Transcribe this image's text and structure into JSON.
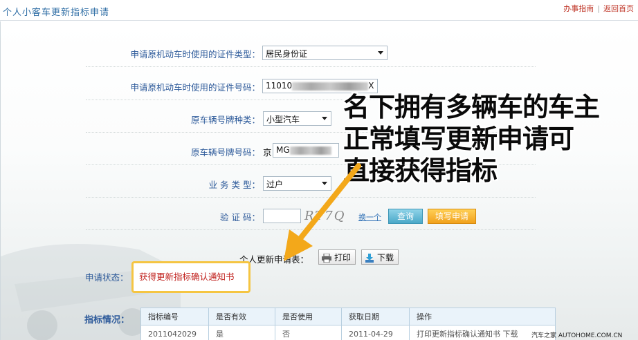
{
  "header": {
    "title": "个人小客车更新指标申请",
    "link_guide": "办事指南",
    "link_home": "返回首页"
  },
  "form": {
    "id_type_label": "申请原机动车时使用的证件类型：",
    "id_type_value": "居民身份证",
    "id_number_label": "申请原机动车时使用的证件号码：",
    "id_number_prefix": "11010",
    "id_number_suffix": "X",
    "plate_type_label": "原车辆号牌种类：",
    "plate_type_value": "小型汽车",
    "plate_number_label": "原车辆号牌号码：",
    "plate_prefix": "京",
    "plate_value_prefix": "MG",
    "business_type_label": "业 务 类 型：",
    "business_type_value": "过户",
    "captcha_label": "验 证 码：",
    "captcha_text": "RT7Q",
    "refresh_link": "换一个",
    "query_button": "查询",
    "apply_button": "填写申请"
  },
  "actions": {
    "form_label": "个人更新申请表：",
    "print_button": "打印",
    "download_button": "下载"
  },
  "status": {
    "label": "申请状态：",
    "value": "获得更新指标确认通知书"
  },
  "indicator": {
    "label": "指标情况：",
    "columns": [
      "指标编号",
      "是否有效",
      "是否使用",
      "获取日期",
      "操作"
    ],
    "rows": [
      {
        "id": "2011042029",
        "valid": "是",
        "used": "否",
        "date": "2011-04-29",
        "op_print": "打印更新指标确认通知书",
        "op_download": "下载"
      }
    ]
  },
  "annotation": {
    "line1": "名下拥有多辆车的车主",
    "line2": "正常填写更新申请可",
    "line3": "直接获得指标"
  },
  "watermark": "汽车之家 AUTOHOME.COM.CN",
  "colors": {
    "link_blue": "#2d5a9a",
    "status_red": "#c0201c",
    "highlight_yellow": "#f5c542",
    "arrow_orange": "#f3a81a"
  }
}
